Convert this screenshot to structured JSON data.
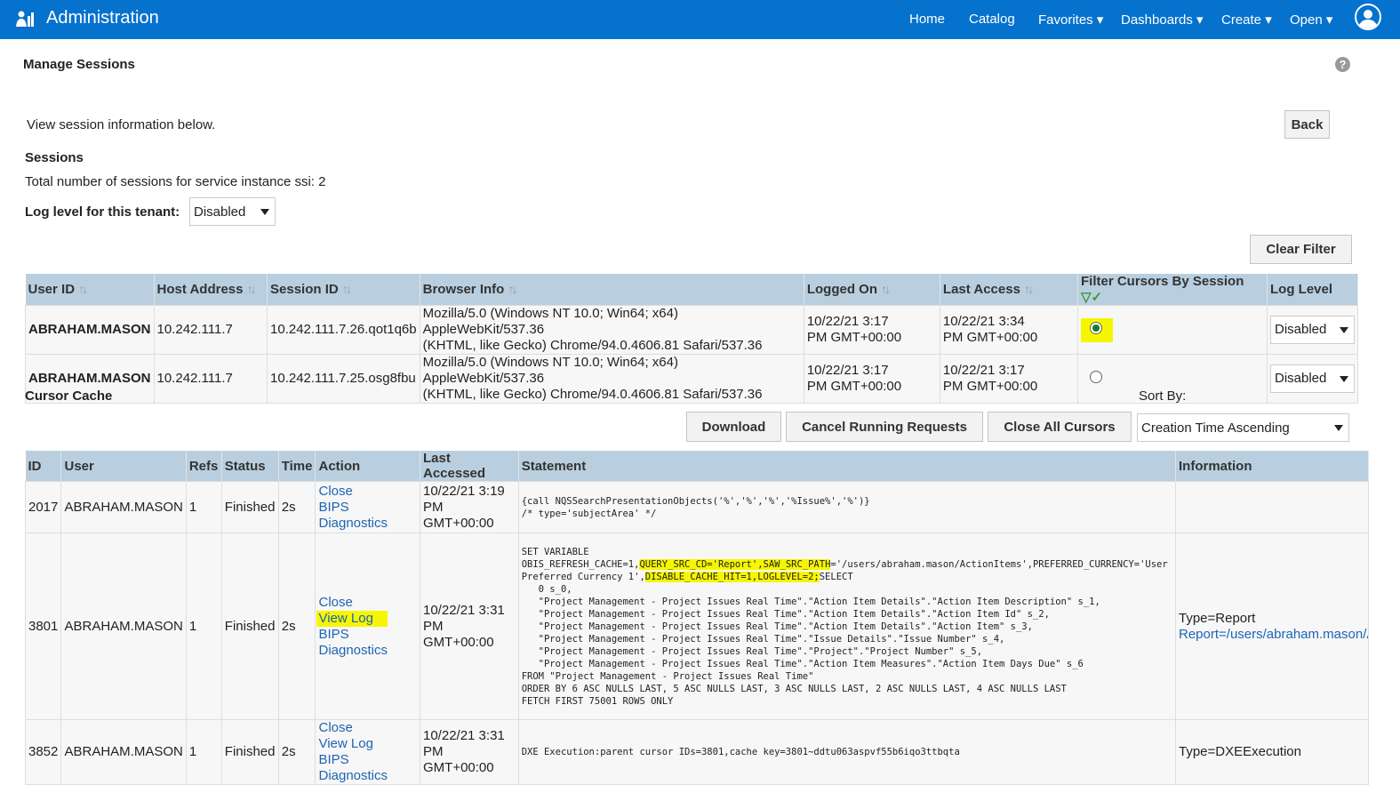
{
  "header": {
    "title": "Administration",
    "nav": [
      "Home",
      "Catalog",
      "Favorites",
      "Dashboards",
      "Create",
      "Open"
    ]
  },
  "page": {
    "title": "Manage Sessions",
    "intro": "View session information below.",
    "back": "Back",
    "sessions_heading": "Sessions",
    "total": "Total number of sessions for service instance ssi: 2",
    "log_level_label": "Log level for this tenant:",
    "log_level_value": "Disabled",
    "clear_filter": "Clear Filter"
  },
  "sessions": {
    "columns": [
      "User ID",
      "Host Address",
      "Session ID",
      "Browser Info",
      "Logged On",
      "Last Access",
      "Filter Cursors By Session",
      "Log Level"
    ],
    "rows": [
      {
        "user": "ABRAHAM.MASON",
        "host": "10.242.111.7",
        "session": "10.242.111.7.26.qot1q6b",
        "browser1": "Mozilla/5.0 (Windows NT 10.0; Win64; x64) AppleWebKit/537.36",
        "browser2": "(KHTML, like Gecko) Chrome/94.0.4606.81 Safari/537.36",
        "logged1": "10/22/21 3:17",
        "logged2": "PM GMT+00:00",
        "last1": "10/22/21 3:34",
        "last2": "PM GMT+00:00",
        "selected": true,
        "log": "Disabled"
      },
      {
        "user": "ABRAHAM.MASON",
        "host": "10.242.111.7",
        "session": "10.242.111.7.25.osg8fbu",
        "browser1": "Mozilla/5.0 (Windows NT 10.0; Win64; x64) AppleWebKit/537.36",
        "browser2": "(KHTML, like Gecko) Chrome/94.0.4606.81 Safari/537.36",
        "logged1": "10/22/21 3:17",
        "logged2": "PM GMT+00:00",
        "last1": "10/22/21 3:17",
        "last2": "PM GMT+00:00",
        "selected": false,
        "log": "Disabled"
      }
    ]
  },
  "cursor": {
    "heading": "Cursor Cache",
    "sort_by": "Sort By:",
    "sort_value": "Creation Time Ascending",
    "download": "Download",
    "cancel": "Cancel Running Requests",
    "close_all": "Close All Cursors",
    "columns": [
      "ID",
      "User",
      "Refs",
      "Status",
      "Time",
      "Action",
      "Last Accessed",
      "Statement",
      "Information"
    ],
    "rows": [
      {
        "id": "2017",
        "user": "ABRAHAM.MASON",
        "refs": "1",
        "status": "Finished",
        "time": "2s",
        "actions": [
          "Close",
          "BIPS Diagnostics"
        ],
        "acc1": "10/22/21 3:19",
        "acc2": "PM GMT+00:00",
        "stmt": [
          "{call NQSSearchPresentationObjects('%','%','%','%Issue%','%')}",
          "/* type='subjectArea' */"
        ],
        "info": [
          "",
          ""
        ]
      },
      {
        "id": "3801",
        "user": "ABRAHAM.MASON",
        "refs": "1",
        "status": "Finished",
        "time": "2s",
        "actions": [
          "Close",
          "View Log",
          "BIPS Diagnostics"
        ],
        "acc1": "10/22/21 3:31",
        "acc2": "PM GMT+00:00",
        "s0": "SET VARIABLE",
        "s1a": "OBIS_REFRESH_CACHE=1,",
        "s1b": "QUERY_SRC_CD='Report',SAW_SRC_PATH",
        "s1c": "='/users/abraham.mason/ActionItems',PREFERRED_CURRENCY='User",
        "s2a": "Preferred Currency 1',",
        "s2b": "DISABLE_CACHE_HIT=1,LOGLEVEL=2;",
        "s2c": "SELECT",
        "stmt": [
          "   0 s_0,",
          "   \"Project Management - Project Issues Real Time\".\"Action Item Details\".\"Action Item Description\" s_1,",
          "   \"Project Management - Project Issues Real Time\".\"Action Item Details\".\"Action Item Id\" s_2,",
          "   \"Project Management - Project Issues Real Time\".\"Action Item Details\".\"Action Item\" s_3,",
          "   \"Project Management - Project Issues Real Time\".\"Issue Details\".\"Issue Number\" s_4,",
          "   \"Project Management - Project Issues Real Time\".\"Project\".\"Project Number\" s_5,",
          "   \"Project Management - Project Issues Real Time\".\"Action Item Measures\".\"Action Item Days Due\" s_6",
          "FROM \"Project Management - Project Issues Real Time\"",
          "ORDER BY 6 ASC NULLS LAST, 5 ASC NULLS LAST, 3 ASC NULLS LAST, 2 ASC NULLS LAST, 4 ASC NULLS LAST",
          "FETCH FIRST 75001 ROWS ONLY"
        ],
        "info": [
          "Type=Report",
          "Report=/users/abraham.mason/ActionItems"
        ]
      },
      {
        "id": "3852",
        "user": "ABRAHAM.MASON",
        "refs": "1",
        "status": "Finished",
        "time": "2s",
        "actions": [
          "Close",
          "View Log",
          "BIPS Diagnostics"
        ],
        "acc1": "10/22/21 3:31",
        "acc2": "PM GMT+00:00",
        "stmt": [
          "DXE Execution:parent cursor IDs=3801,cache key=3801~ddtu063aspvf55b6iqo3ttbqta"
        ],
        "info": [
          "Type=DXEExecution",
          ""
        ]
      }
    ]
  }
}
